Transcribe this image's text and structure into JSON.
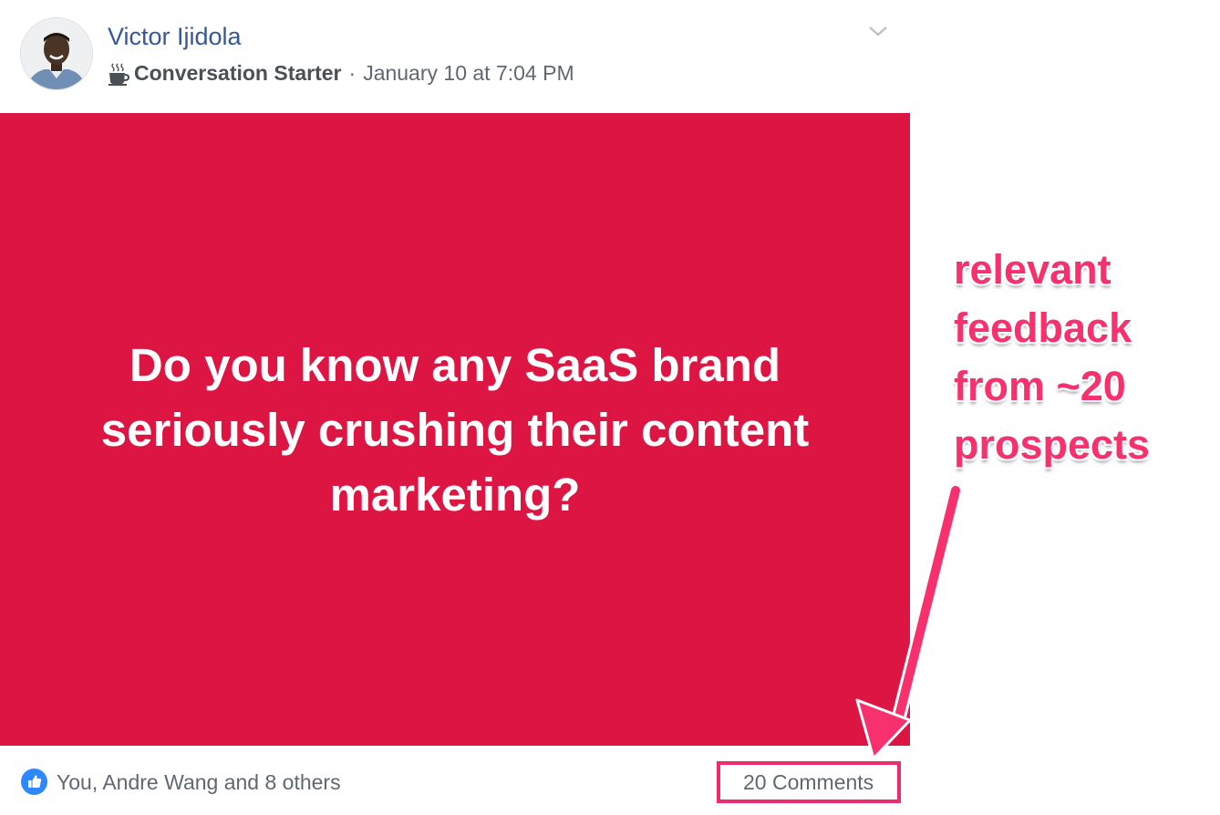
{
  "post": {
    "author": "Victor Ijidola",
    "badge_icon": "coffee-cup-icon",
    "badge": "Conversation Starter",
    "separator": "·",
    "timestamp": "January 10 at 7:04 PM",
    "menu_icon": "chevron-down-icon",
    "text": "Do you know any SaaS brand seriously crushing their content marketing?",
    "background_color": "#dc1543"
  },
  "footer": {
    "like_icon": "thumbs-up-icon",
    "reactions": "You, Andre Wang and 8 others",
    "comments": "20 Comments"
  },
  "annotation": {
    "text": "relevant\nfeedback\nfrom ~20\nprospects",
    "color": "#f7306e"
  }
}
